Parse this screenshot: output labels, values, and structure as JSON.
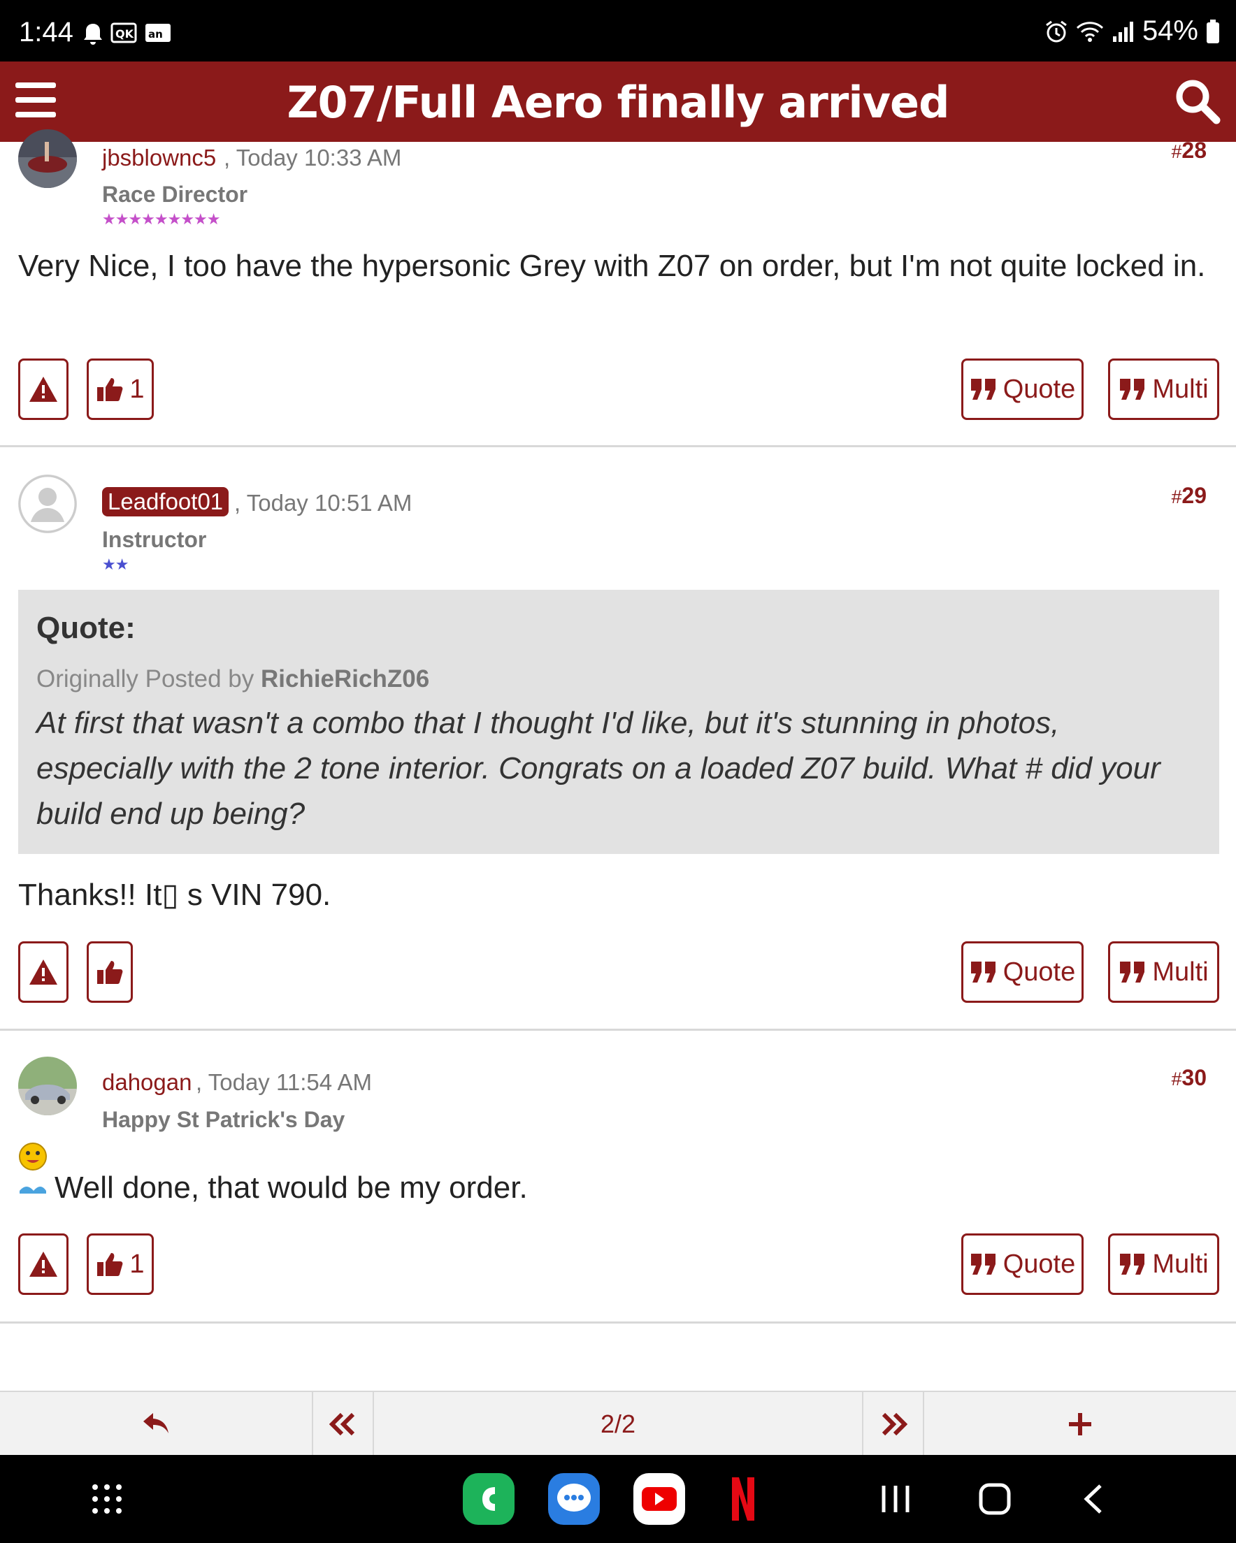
{
  "status_bar": {
    "time": "1:44",
    "battery": "54%"
  },
  "app_bar": {
    "title": "Z07/Full Aero finally arrived"
  },
  "posts": [
    {
      "username": "jbsblownc5",
      "time": ", Today 10:33 AM",
      "rank": "Race Director",
      "stars": "★★★★★★★★★",
      "number_prefix": "#",
      "number": "28",
      "body": "Very Nice, I too have the hypersonic Grey with Z07 on order, but I'm not quite locked in.",
      "like_count": "1",
      "quote_label": "Quote",
      "multi_label": "Multi"
    },
    {
      "username": "Leadfoot01",
      "time": ", Today 10:51 AM",
      "rank": "Instructor",
      "stars": "★★",
      "number_prefix": "#",
      "number": "29",
      "quote": {
        "label": "Quote:",
        "by_prefix": "Originally Posted by ",
        "by_user": "RichieRichZ06",
        "text": "At first that wasn't a combo that I thought I'd like, but it's stunning in photos, especially with the 2 tone interior. Congrats on a loaded Z07 build. What # did your build end up being?"
      },
      "body": "Thanks!! It▯ s VIN 790.",
      "quote_label": "Quote",
      "multi_label": "Multi"
    },
    {
      "username": "dahogan",
      "time": ", Today 11:54 AM",
      "rank": "Happy St Patrick's Day",
      "number_prefix": "#",
      "number": "30",
      "body": "Well done, that would be my order.",
      "like_count": "1",
      "quote_label": "Quote",
      "multi_label": "Multi"
    }
  ],
  "bottom_nav": {
    "page": "2/2"
  },
  "icons": {
    "menu": "hamburger-icon",
    "search": "search-icon",
    "report": "warning-icon",
    "like": "thumbs-up-icon",
    "quote": "quote-icon",
    "reply": "reply-icon",
    "first": "double-chevron-left-icon",
    "last": "double-chevron-right-icon",
    "add": "plus-icon"
  },
  "colors": {
    "brand": "#8b1a1a",
    "quote_bg": "#e2e2e2"
  }
}
